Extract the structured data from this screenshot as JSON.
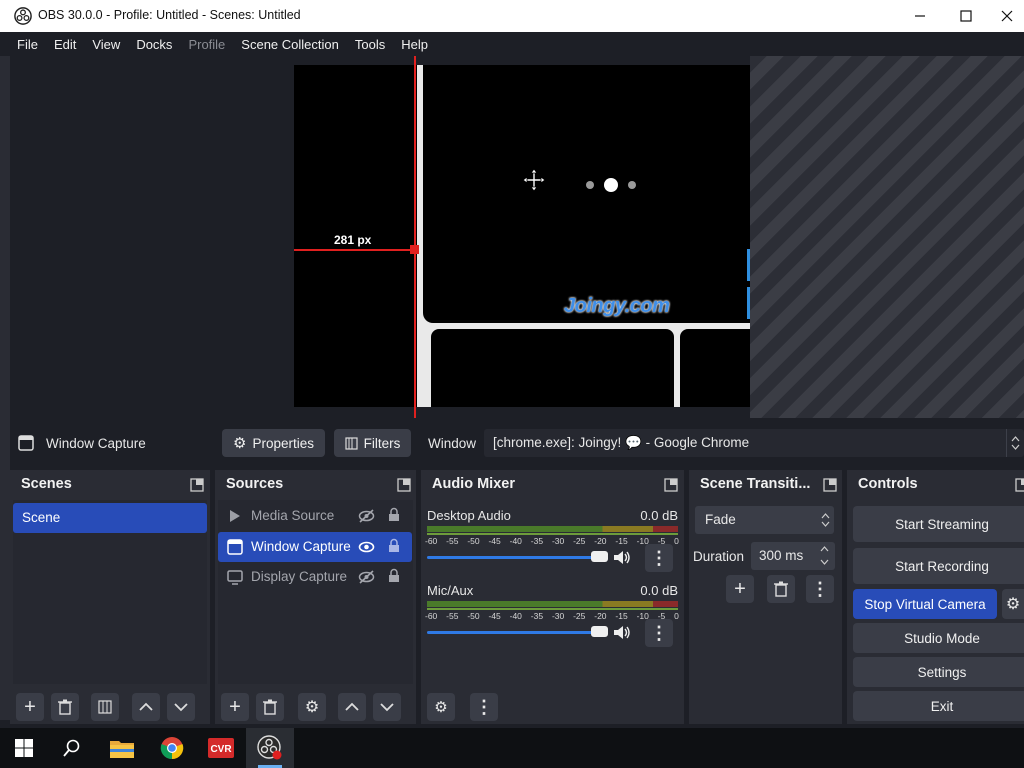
{
  "window": {
    "title": "OBS 30.0.0 - Profile: Untitled - Scenes: Untitled"
  },
  "menu": [
    {
      "label": "File",
      "enabled": true
    },
    {
      "label": "Edit",
      "enabled": true
    },
    {
      "label": "View",
      "enabled": true
    },
    {
      "label": "Docks",
      "enabled": true
    },
    {
      "label": "Profile",
      "enabled": false
    },
    {
      "label": "Scene Collection",
      "enabled": true
    },
    {
      "label": "Tools",
      "enabled": true
    },
    {
      "label": "Help",
      "enabled": true
    }
  ],
  "preview": {
    "distance_label": "281 px",
    "watermark": "Joingy.com",
    "guide_color": "#e0201f"
  },
  "source_toolbar": {
    "selected_source": "Window Capture",
    "properties_label": "Properties",
    "filters_label": "Filters",
    "window_label": "Window",
    "window_value": "[chrome.exe]: Joingy! 💬 - Google Chrome"
  },
  "scenes": {
    "title": "Scenes",
    "items": [
      {
        "label": "Scene",
        "selected": true
      }
    ]
  },
  "sources": {
    "title": "Sources",
    "items": [
      {
        "label": "Media Source",
        "icon": "play-icon",
        "visible": false,
        "selected": false
      },
      {
        "label": "Window Capture",
        "icon": "window-icon",
        "visible": true,
        "selected": true
      },
      {
        "label": "Display Capture",
        "icon": "monitor-icon",
        "visible": false,
        "selected": false
      }
    ]
  },
  "audio_mixer": {
    "title": "Audio Mixer",
    "scale": [
      "-60",
      "-55",
      "-50",
      "-45",
      "-40",
      "-35",
      "-30",
      "-25",
      "-20",
      "-15",
      "-10",
      "-5",
      "0"
    ],
    "channels": [
      {
        "name": "Desktop Audio",
        "level": "0.0 dB",
        "volume": 1.0
      },
      {
        "name": "Mic/Aux",
        "level": "0.0 dB",
        "volume": 1.0
      }
    ]
  },
  "transitions": {
    "title": "Scene Transiti...",
    "transition": "Fade",
    "duration_label": "Duration",
    "duration_value": "300 ms"
  },
  "controls": {
    "title": "Controls",
    "start_streaming": "Start Streaming",
    "start_recording": "Start Recording",
    "virtual_camera": "Stop Virtual Camera",
    "studio_mode": "Studio Mode",
    "settings": "Settings",
    "exit": "Exit",
    "accent": "#284cb8"
  },
  "taskbar": {
    "items": [
      "windows-start-icon",
      "search-icon",
      "file-explorer-icon",
      "chrome-icon",
      "vr-app-icon",
      "obs-icon"
    ]
  }
}
